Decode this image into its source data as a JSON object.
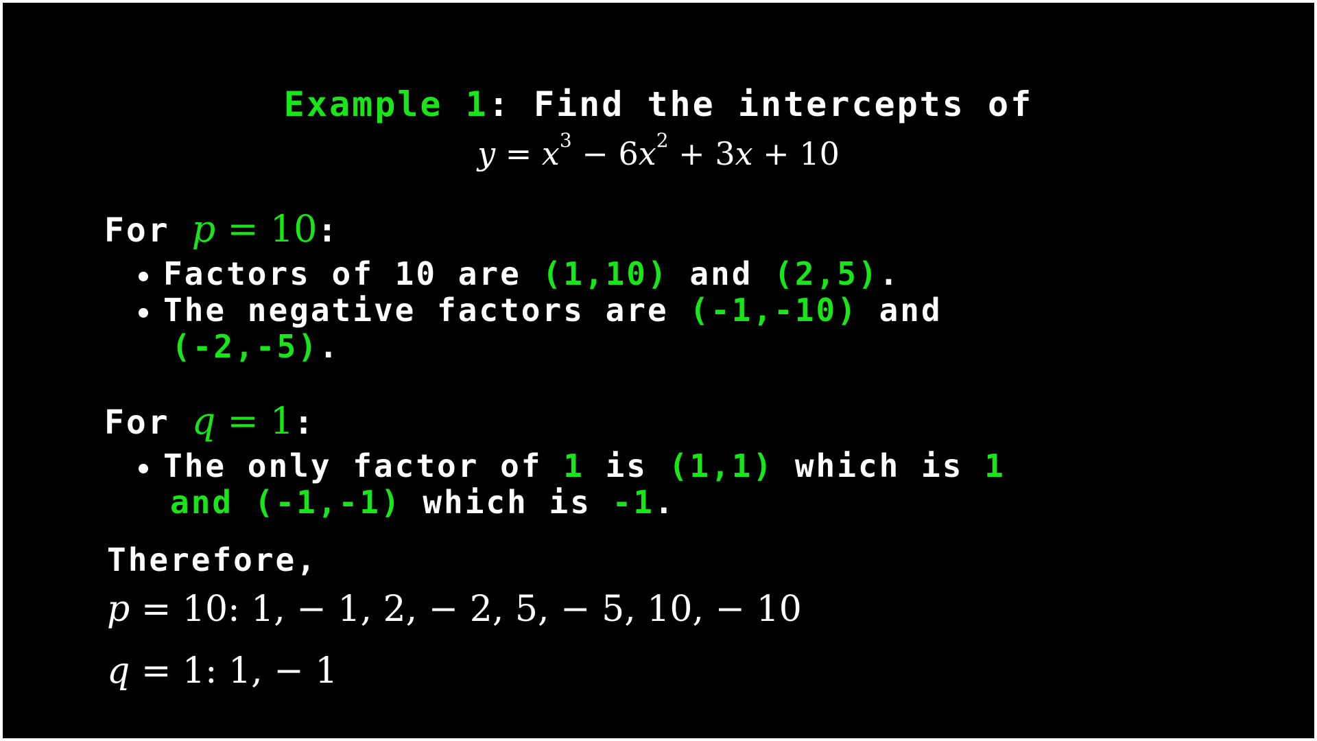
{
  "title": {
    "label": "Example 1",
    "rest": ": Find the intercepts of"
  },
  "equation": {
    "y": "y",
    "eq": " = ",
    "x1": "x",
    "exp1": "3",
    "t2": " − 6",
    "x2": "x",
    "exp2": "2",
    "t3": " + 3",
    "x3": "x",
    "t4": " + 10"
  },
  "p_section": {
    "prefix": "For ",
    "var": "p",
    "value": " = 10",
    "suffix": ":",
    "bullet1": {
      "a": "Factors of 10 are ",
      "b": "(1,10)",
      "c": " and ",
      "d": "(2,5)",
      "e": "."
    },
    "bullet2": {
      "a": "The negative factors are ",
      "b": "(-1,-10)",
      "c": " and",
      "d": "(-2,-5)",
      "e": "."
    }
  },
  "q_section": {
    "prefix": "For ",
    "var": "q",
    "value": " = 1",
    "suffix": ":",
    "bullet1": {
      "a": "The only factor of ",
      "b": "1",
      "c": " is ",
      "d": "(1,1)",
      "e": " which is ",
      "f": "1",
      "g": "and (-1,-1)",
      "h": " which is ",
      "i": "-1",
      "j": "."
    }
  },
  "therefore": "Therefore,",
  "results": {
    "p_var": "p",
    "p_text": " = 10: 1,  − 1, 2,  − 2, 5,  − 5, 10,  − 10",
    "q_var": "q",
    "q_text": " = 1: 1,  − 1"
  },
  "colors": {
    "background": "#000000",
    "accent": "#19e619",
    "text": "#ffffff"
  }
}
